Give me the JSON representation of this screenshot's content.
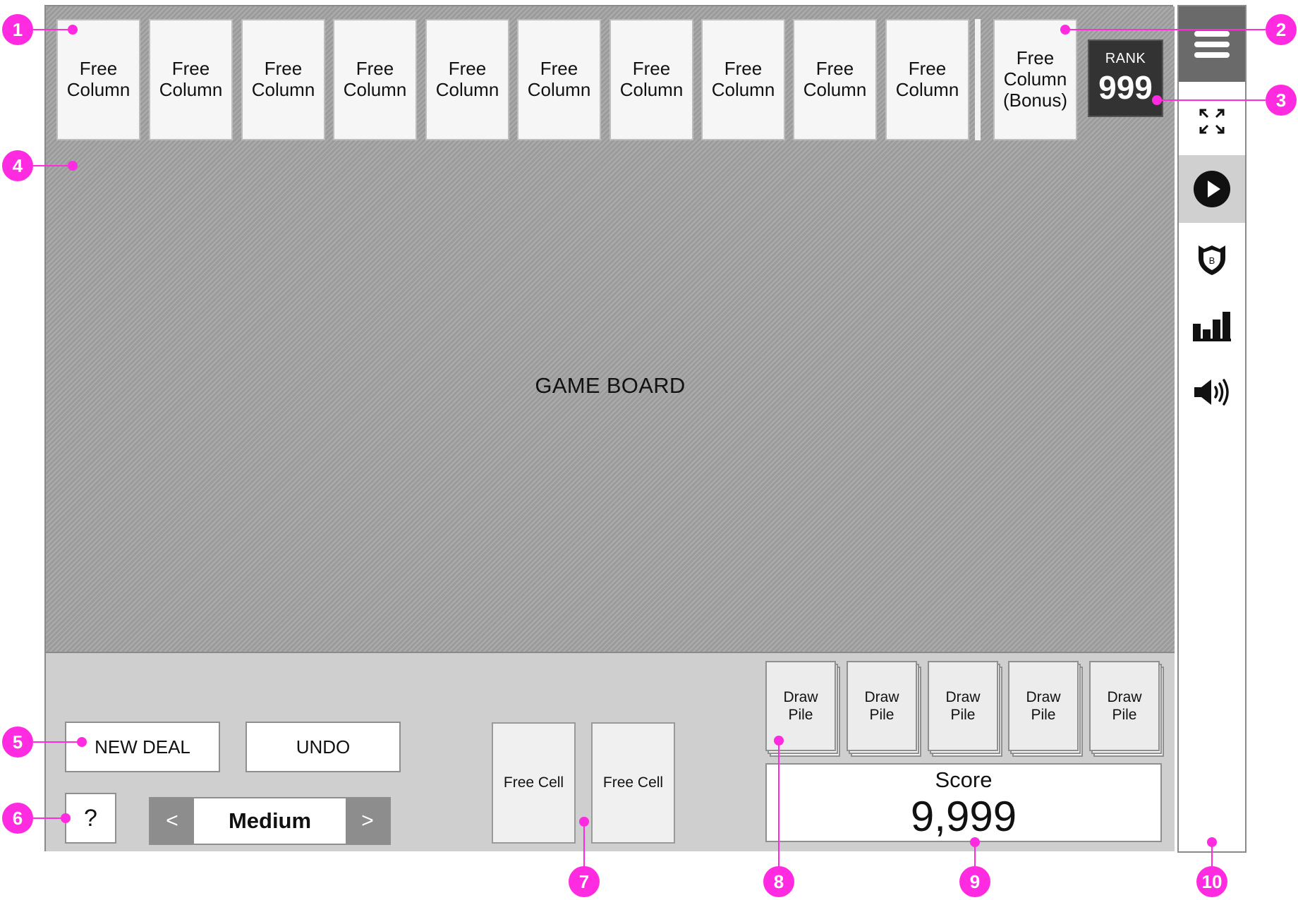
{
  "board": {
    "free_column_label": "Free\nColumn",
    "bonus_column_label": "Free\nColumn\n(Bonus)",
    "label": "GAME BOARD",
    "rank": {
      "label": "RANK",
      "value": "999"
    }
  },
  "controls": {
    "new_deal_label": "NEW DEAL",
    "undo_label": "UNDO",
    "help_label": "?",
    "level": {
      "prev": "<",
      "value": "Medium",
      "next": ">"
    },
    "free_cell_label": "Free Cell",
    "draw_pile_label": "Draw\nPile",
    "score": {
      "label": "Score",
      "value": "9,999"
    }
  },
  "sidebar": {
    "icons": [
      "menu-icon",
      "fullscreen-icon",
      "play-icon",
      "badge-shield-icon",
      "stats-bar-chart-icon",
      "sound-icon"
    ]
  },
  "annotations": {
    "markers": [
      "1",
      "2",
      "3",
      "4",
      "5",
      "6",
      "7",
      "8",
      "9",
      "10"
    ]
  },
  "colors": {
    "marker": "#ff2be0",
    "board": "#a3a3a3",
    "panel": "#cfcfcf",
    "rank_bg": "#333333"
  }
}
